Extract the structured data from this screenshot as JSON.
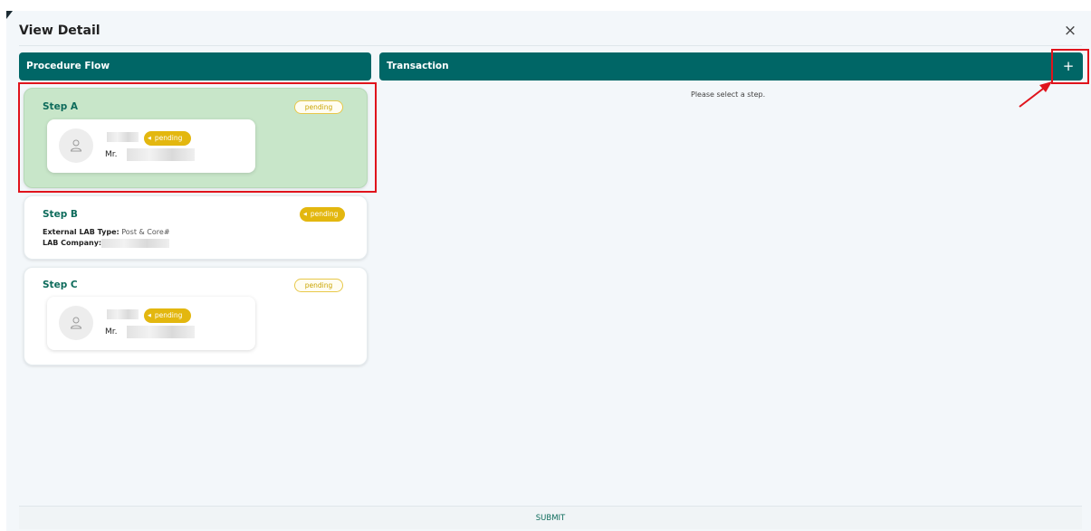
{
  "dialog": {
    "title": "View Detail",
    "close_symbol": "×"
  },
  "procedure_flow": {
    "header": "Procedure Flow",
    "steps": [
      {
        "title": "Step A",
        "status": "pending",
        "person": {
          "status": "pending",
          "name_prefix": "Mr."
        }
      },
      {
        "title": "Step B",
        "status": "pending",
        "lab_type_label": "External LAB Type:",
        "lab_type_value": "Post & Core#",
        "lab_company_label": "LAB Company:"
      },
      {
        "title": "Step C",
        "status": "pending",
        "person": {
          "status": "pending",
          "name_prefix": "Mr."
        }
      }
    ]
  },
  "transaction": {
    "header": "Transaction",
    "add_symbol": "+",
    "empty_message": "Please select a step."
  },
  "footer": {
    "submit_label": "SUBMIT"
  },
  "colors": {
    "header_bg": "#006666",
    "selected_step_bg": "#c8e6c9",
    "pending_badge": "#e3b70f",
    "highlight": "#e0141c"
  },
  "icons": {
    "close": "close-icon",
    "add": "plus-icon",
    "avatar": "user-icon",
    "badge_caret": "caret-left-icon"
  }
}
